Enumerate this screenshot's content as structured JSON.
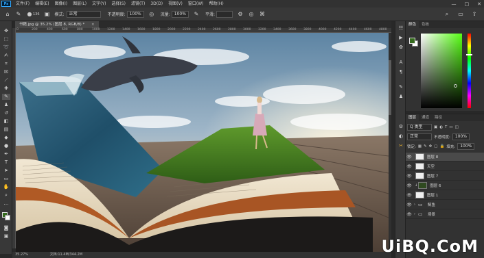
{
  "menubar": {
    "logo": "Ps",
    "items": [
      "文件(F)",
      "编辑(E)",
      "图像(I)",
      "图层(L)",
      "文字(Y)",
      "选择(S)",
      "滤镜(T)",
      "3D(D)",
      "视图(V)",
      "窗口(W)",
      "帮助(H)"
    ],
    "window_controls": [
      "—",
      "□",
      "✕"
    ]
  },
  "options": {
    "brush_size": "136",
    "mode_label": "模式:",
    "mode_value": "正常",
    "opacity_label": "不透明度:",
    "opacity_value": "100%",
    "flow_label": "流量:",
    "flow_value": "100%",
    "smoothing_label": "平滑:",
    "smoothing_value": ""
  },
  "document": {
    "tab_title": "书籍.jpg @ 35.2% (图层 8, RGB/8) *",
    "close": "×"
  },
  "ruler_ticks": [
    "0",
    "200",
    "400",
    "600",
    "800",
    "1000",
    "1200",
    "1400",
    "1600",
    "1800",
    "2000",
    "2200",
    "2400",
    "2600",
    "2800",
    "3000",
    "3200",
    "3400",
    "3600",
    "3800",
    "4000",
    "4200",
    "4400",
    "4600",
    "4800"
  ],
  "status": {
    "zoom": "35.27%",
    "doc_size": "文档:11.4M/344.2M"
  },
  "color_panel": {
    "tabs": [
      "颜色",
      "色板"
    ],
    "fg_color": "#356b1e",
    "bg_color": "#ffffff"
  },
  "layers_panel": {
    "tabs": [
      "图层",
      "通道",
      "路径"
    ],
    "filter_label": "Q 类型",
    "blend_mode": "正常",
    "opacity_label": "不透明度:",
    "opacity_value": "100%",
    "lock_label": "锁定:",
    "fill_label": "填充:",
    "fill_value": "100%",
    "layers": [
      {
        "name": "图层 8",
        "type": "pixel",
        "selected": true
      },
      {
        "name": "天空",
        "type": "pixel",
        "selected": false
      },
      {
        "name": "图层 7",
        "type": "pixel",
        "selected": false
      },
      {
        "name": "图层 6",
        "type": "pixel-dark",
        "selected": false
      },
      {
        "name": "图层 1",
        "type": "pixel",
        "selected": false
      },
      {
        "name": "鲸鱼",
        "type": "group",
        "selected": false
      },
      {
        "name": "场景",
        "type": "group",
        "selected": false
      }
    ]
  },
  "watermark": "UiBQ.CoM",
  "colors": {
    "ui_dark": "#282828",
    "panel": "#323232",
    "accent_ps": "#31a8ff"
  }
}
